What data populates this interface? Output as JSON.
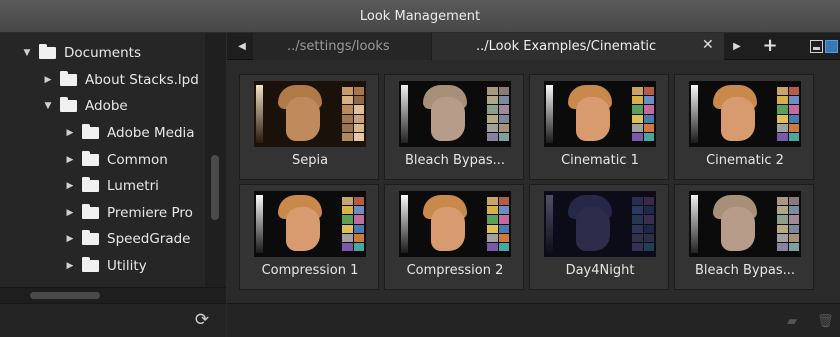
{
  "window": {
    "title": "Look Management"
  },
  "tree": {
    "items": [
      {
        "label": "Documents",
        "level": 0,
        "expanded": true
      },
      {
        "label": "About Stacks.lpd",
        "level": 1,
        "expanded": false
      },
      {
        "label": "Adobe",
        "level": 1,
        "expanded": true
      },
      {
        "label": "Adobe Media",
        "level": 2,
        "expanded": false
      },
      {
        "label": "Common",
        "level": 2,
        "expanded": false
      },
      {
        "label": "Lumetri",
        "level": 2,
        "expanded": false
      },
      {
        "label": "Premiere Pro",
        "level": 2,
        "expanded": false
      },
      {
        "label": "SpeedGrade",
        "level": 2,
        "expanded": false
      },
      {
        "label": "Utility",
        "level": 2,
        "expanded": false
      }
    ]
  },
  "tabs": [
    {
      "label": "../settings/looks",
      "active": false
    },
    {
      "label": "../Look Examples/Cinematic",
      "active": true
    }
  ],
  "icons": {
    "tab_prev": "chevron-left-icon",
    "tab_next": "chevron-right-icon",
    "tab_close": "close-icon",
    "add_tab": "plus-icon",
    "refresh": "refresh-icon",
    "view_list": "list-view-icon",
    "view_grid": "grid-view-icon",
    "move": "move-to-folder-icon",
    "delete": "trash-icon"
  },
  "looks": [
    {
      "label": "Sepia",
      "tone": "sepia"
    },
    {
      "label": "Bleach Bypas...",
      "tone": "bleach"
    },
    {
      "label": "Cinematic 1",
      "tone": "normal"
    },
    {
      "label": "Cinematic 2",
      "tone": "normal"
    },
    {
      "label": "Compression 1",
      "tone": "normal"
    },
    {
      "label": "Compression 2",
      "tone": "normal"
    },
    {
      "label": "Day4Night",
      "tone": "night"
    },
    {
      "label": "Bleach Bypas...",
      "tone": "bleach"
    }
  ],
  "colors": {
    "accent": "#3a78b5",
    "skin_normal": "#d79b6f",
    "skin_sepia": "#c08a5c",
    "skin_bleach": "#b89c8a",
    "skin_night": "#2b2d4a"
  }
}
